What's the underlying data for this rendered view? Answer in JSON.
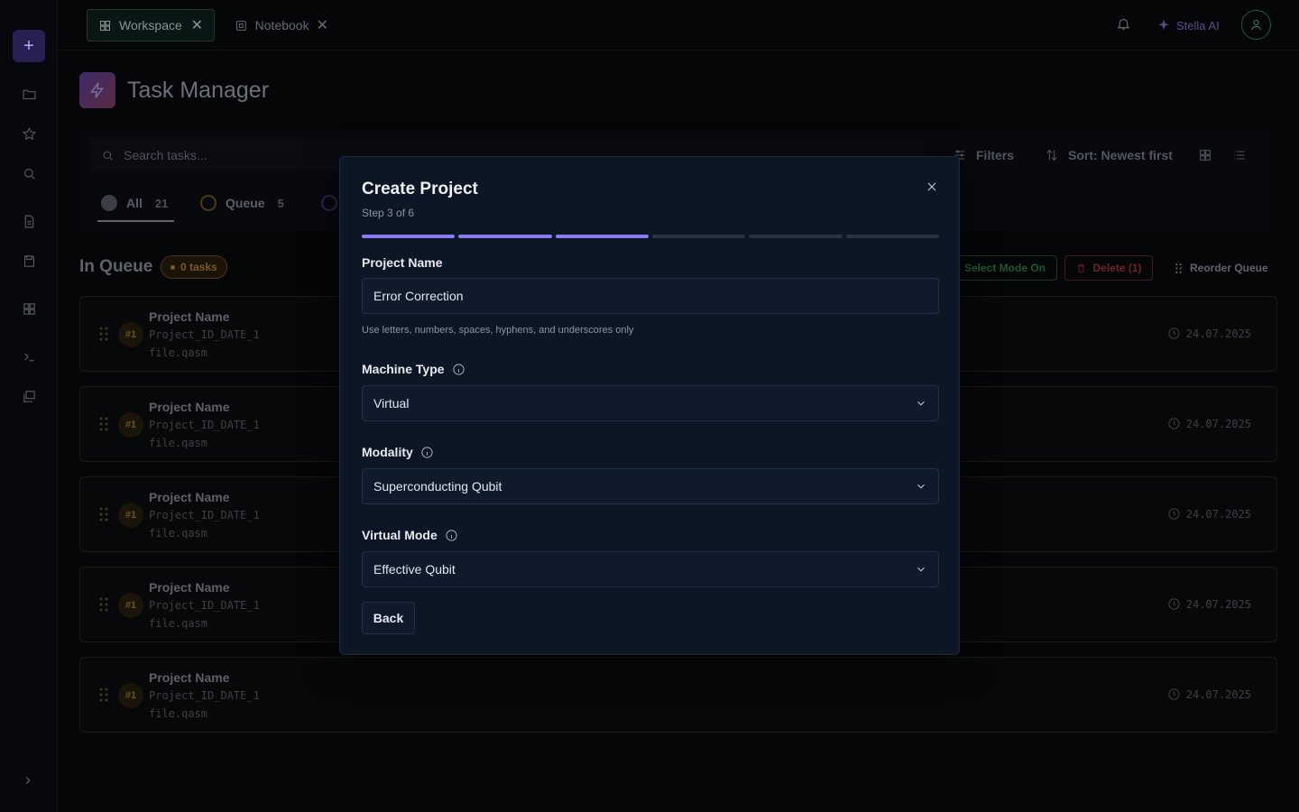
{
  "tabs": [
    {
      "label": "Workspace",
      "icon": "grid-icon"
    },
    {
      "label": "Notebook",
      "icon": "notebook-icon"
    }
  ],
  "header": {
    "assistant_label": "Stella AI"
  },
  "page": {
    "title": "Task Manager"
  },
  "toolbar": {
    "search_placeholder": "Search tasks...",
    "filters_label": "Filters",
    "sort_label": "Sort: Newest first"
  },
  "segments": [
    {
      "label": "All",
      "count": "21"
    },
    {
      "label": "Queue",
      "count": "5"
    }
  ],
  "queue": {
    "title": "In Queue",
    "badge": "0 tasks",
    "select_mode_label": "Select Mode On",
    "delete_label": "Delete (1)",
    "reorder_label": "Reorder Queue",
    "rows": [
      {
        "num": "#1",
        "name": "Project Name",
        "id": "Project_ID_DATE_1",
        "file": "file.qasm",
        "date": "24.07.2025"
      },
      {
        "num": "#1",
        "name": "Project Name",
        "id": "Project_ID_DATE_1",
        "file": "file.qasm",
        "date": "24.07.2025"
      },
      {
        "num": "#1",
        "name": "Project Name",
        "id": "Project_ID_DATE_1",
        "file": "file.qasm",
        "date": "24.07.2025"
      },
      {
        "num": "#1",
        "name": "Project Name",
        "id": "Project_ID_DATE_1",
        "file": "file.qasm",
        "date": "24.07.2025"
      },
      {
        "num": "#1",
        "name": "Project Name",
        "id": "Project_ID_DATE_1",
        "file": "file.qasm",
        "date": "24.07.2025"
      }
    ]
  },
  "modal": {
    "title": "Create Project",
    "step": "Step 3 of 6",
    "progress_done": 3,
    "progress_total": 6,
    "project_name_label": "Project Name",
    "project_name_value": "Error Correction",
    "project_name_hint": "Use letters, numbers, spaces, hyphens, and underscores only",
    "machine_type_label": "Machine Type",
    "machine_type_value": "Virtual",
    "modality_label": "Modality",
    "modality_value": "Superconducting Qubit",
    "virtual_mode_label": "Virtual Mode",
    "virtual_mode_value": "Effective Qubit",
    "back_label": "Back"
  },
  "colors": {
    "accent": "#8a7cf0",
    "modal_bg": "#0d1624"
  }
}
